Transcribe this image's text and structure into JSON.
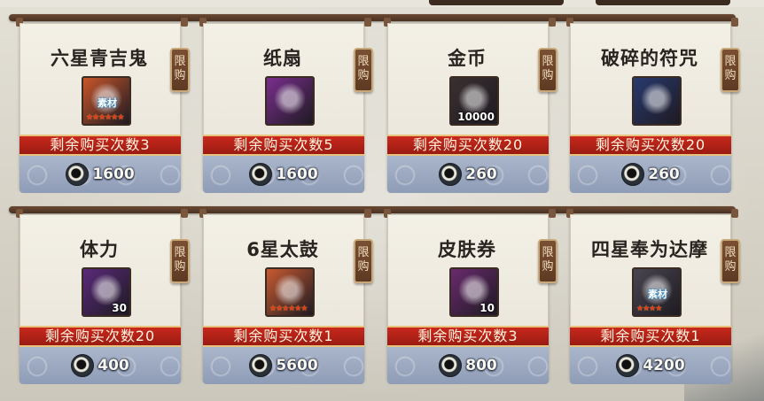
{
  "limit_tag": [
    "限",
    "购"
  ],
  "items": [
    {
      "name": "六星青吉鬼",
      "remaining": "剩余购买次数3",
      "price": "1600",
      "icon": "green-ghost-icon",
      "badge": "素材",
      "stars": "★★★★★★",
      "qty": "",
      "icon_bg": "#c8562a"
    },
    {
      "name": "纸扇",
      "remaining": "剩余购买次数5",
      "price": "1600",
      "icon": "paper-fan-icon",
      "badge": "",
      "stars": "",
      "qty": "",
      "icon_bg": "#7a2e8e"
    },
    {
      "name": "金币",
      "remaining": "剩余购买次数20",
      "price": "260",
      "icon": "gold-coin-icon",
      "badge": "",
      "stars": "",
      "qty": "10000",
      "icon_bg": "#3a3030"
    },
    {
      "name": "破碎的符咒",
      "remaining": "剩余购买次数20",
      "price": "260",
      "icon": "broken-charm-icon",
      "badge": "",
      "stars": "",
      "qty": "",
      "icon_bg": "#283a6e"
    },
    {
      "name": "体力",
      "remaining": "剩余购买次数20",
      "price": "400",
      "icon": "stamina-sushi-icon",
      "badge": "",
      "stars": "",
      "qty": "30",
      "icon_bg": "#5a2a7a"
    },
    {
      "name": "6星太鼓",
      "remaining": "剩余购买次数1",
      "price": "5600",
      "icon": "taiko-drum-icon",
      "badge": "",
      "stars": "★★★★★★",
      "qty": "",
      "icon_bg": "#c85a30"
    },
    {
      "name": "皮肤券",
      "remaining": "剩余购买次数3",
      "price": "800",
      "icon": "skin-ticket-icon",
      "badge": "",
      "stars": "",
      "qty": "10",
      "icon_bg": "#6a2a6e"
    },
    {
      "name": "四星奉为达摩",
      "remaining": "剩余购买次数1",
      "price": "4200",
      "icon": "daruma-icon",
      "badge": "素材",
      "stars": "★★★★",
      "qty": "",
      "icon_bg": "#4a4650"
    }
  ]
}
